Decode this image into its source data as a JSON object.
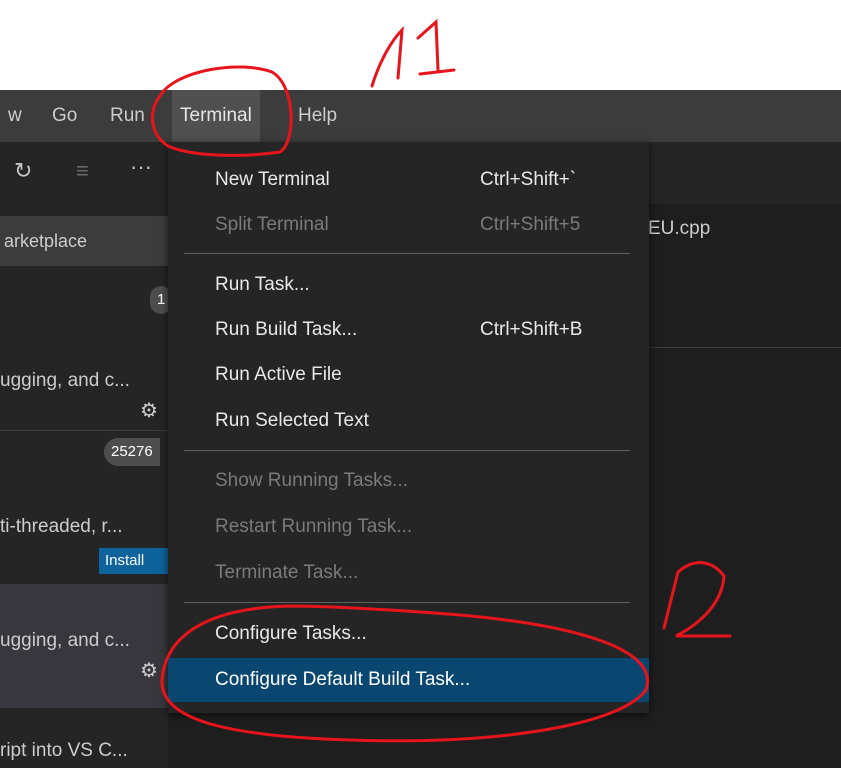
{
  "menubar": {
    "items": [
      {
        "label": "w"
      },
      {
        "label": "Go"
      },
      {
        "label": "Run"
      },
      {
        "label": "Terminal"
      },
      {
        "label": "Help"
      }
    ]
  },
  "sidebar": {
    "toolbar": {
      "refresh_icon": "↻",
      "clear_icon": "≡",
      "more_icon": "···"
    },
    "search_value": "arketplace",
    "extensions": [
      {
        "desc": "ugging, and c..."
      },
      {
        "badge": "25276",
        "desc": "ti-threaded, r...",
        "install_label": "Install"
      },
      {
        "desc": "ugging, and c..."
      },
      {
        "desc": "ript into VS C..."
      }
    ],
    "top_badge": "1"
  },
  "editor": {
    "tab_label": "EU.cpp"
  },
  "terminal_menu": {
    "items": [
      {
        "label": "New Terminal",
        "shortcut": "Ctrl+Shift+`"
      },
      {
        "label": "Split Terminal",
        "shortcut": "Ctrl+Shift+5"
      },
      {
        "label": "Run Task..."
      },
      {
        "label": "Run Build Task...",
        "shortcut": "Ctrl+Shift+B"
      },
      {
        "label": "Run Active File"
      },
      {
        "label": "Run Selected Text"
      },
      {
        "label": "Show Running Tasks..."
      },
      {
        "label": "Restart Running Task..."
      },
      {
        "label": "Terminate Task..."
      },
      {
        "label": "Configure Tasks..."
      },
      {
        "label": "Configure Default Build Task..."
      }
    ]
  },
  "annotations": {
    "label_1": "1 1",
    "label_2": "2",
    "ink_color": "#e8141b"
  }
}
